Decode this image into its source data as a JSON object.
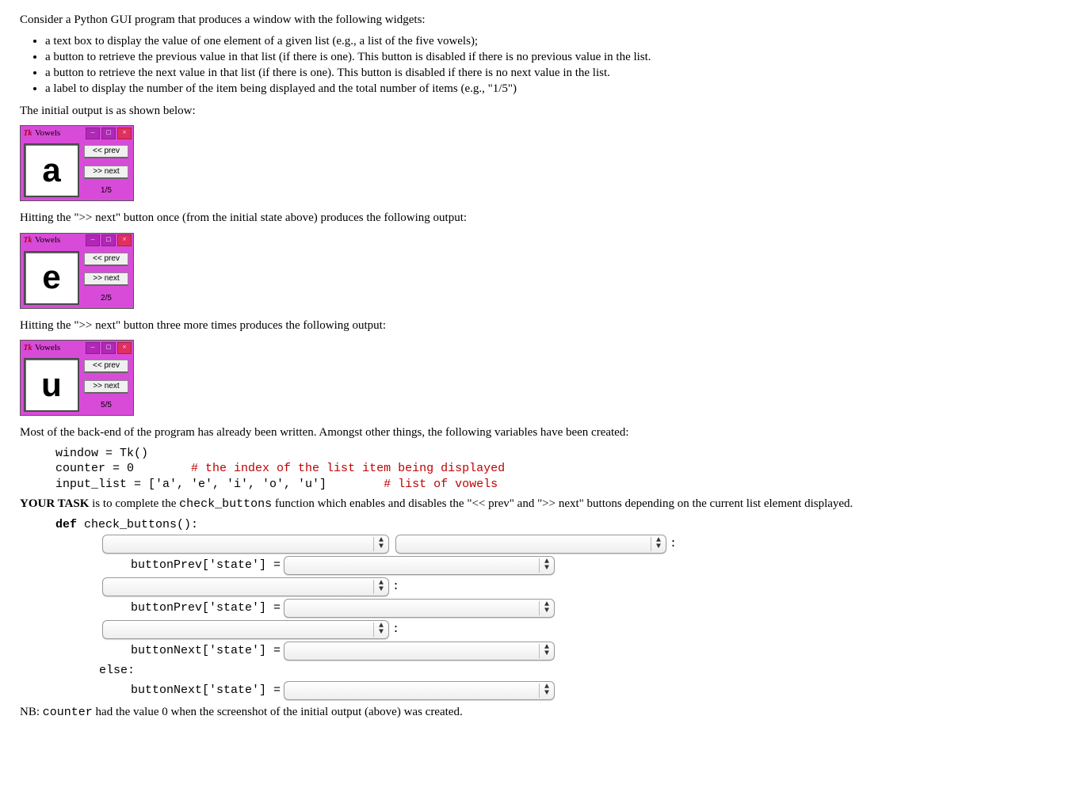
{
  "intro": "Consider a Python GUI program that produces a window with the following widgets:",
  "bullets": [
    "a text box to display the value of one element of a given list (e.g., a list of the five vowels);",
    "a button to retrieve the previous value in that list (if there is one).  This button is disabled if there is no previous value in the list.",
    "a button to retrieve the next value in that list (if there is one).  This button is disabled if there is no next value in the list.",
    "a label to display the number of the item being displayed and the total number of items (e.g., \"1/5\")"
  ],
  "initial_caption": "The initial output is as shown below:",
  "win": {
    "title": "Vowels",
    "tk": "Tk",
    "prev": "<< prev",
    "next": ">> next"
  },
  "w1": {
    "letter": "a",
    "counter": "1/5"
  },
  "after_next_once": "Hitting the \">> next\" button once (from the initial state above) produces the following output:",
  "w2": {
    "letter": "e",
    "counter": "2/5"
  },
  "after_next_three": "Hitting the \">> next\" button three more times produces the following output:",
  "w3": {
    "letter": "u",
    "counter": "5/5"
  },
  "backend_text": "Most of the back-end of the program has already been written.  Amongst other things, the following variables have been created:",
  "code": {
    "l1": "window = Tk()",
    "l2a": "counter = 0        ",
    "l2b": "# the index of the list item being displayed",
    "l3a": "input_list = ['a', 'e', 'i', 'o', 'u']        ",
    "l3b": "# list of vowels"
  },
  "task_prefix": "YOUR TASK",
  "task_mid": " is to complete the ",
  "task_fn": "check_buttons",
  "task_suffix": " function which enables and disables the \"<< prev\" and \">> next\" buttons depending on the current list element displayed.",
  "def_kw": "def",
  "def_rest": " check_buttons():",
  "assign_prev": "buttonPrev['state'] = ",
  "assign_next": "buttonNext['state'] = ",
  "else_kw": "else:",
  "nb": "NB: ",
  "nb_code": "counter",
  "nb_rest": " had the value 0 when the screenshot of the initial output (above) was created.",
  "colon": ":"
}
